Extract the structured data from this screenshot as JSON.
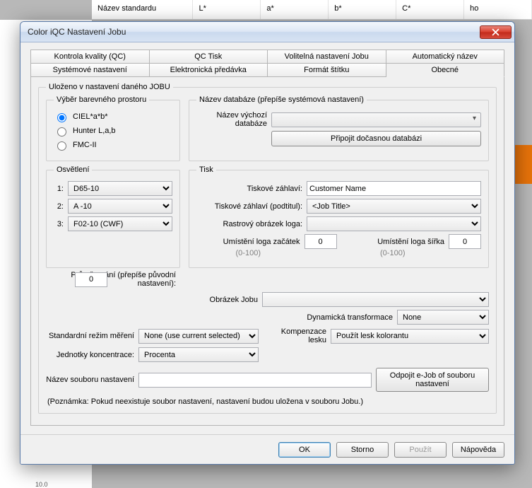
{
  "bg": {
    "headers": [
      "Název standardu",
      "L*",
      "a*",
      "b*",
      "C*",
      "ho"
    ],
    "ruler_tick": "10.0"
  },
  "dialog": {
    "title": "Color iQC Nastavení Jobu",
    "tabs_row1": [
      "Kontrola kvality (QC)",
      "QC Tisk",
      "Volitelná nastavení Jobu",
      "Automatický název"
    ],
    "tabs_row2": [
      "Systémové nastavení",
      "Elektronická předávka",
      "Formát štítku",
      "Obecné"
    ],
    "active_tab": "Obecné",
    "sections": {
      "saved": "Uloženo v nastavení daného JOBU",
      "color_space": {
        "legend": "Výběr barevného prostoru",
        "options": [
          "CIEL*a*b*",
          "Hunter L,a,b",
          "FMC-II"
        ],
        "selected": 0
      },
      "database": {
        "legend": "Název databáze (přepíše systémová nastavení)",
        "default_label": "Název výchozí databáze",
        "attach_btn": "Připojit dočasnou databázi"
      },
      "illum": {
        "legend": "Osvětlení",
        "rows": [
          {
            "n": "1:",
            "value": "D65-10"
          },
          {
            "n": "2:",
            "value": "A  -10"
          },
          {
            "n": "3:",
            "value": "F02-10 (CWF)"
          }
        ],
        "avg_label": "Průměrování (přepíše původní nastavení):",
        "avg_value": "0"
      },
      "print": {
        "legend": "Tisk",
        "header_label": "Tiskové záhlaví:",
        "header_value": "Customer Name",
        "subtitle_label": "Tiskové záhlaví (podtitul):",
        "subtitle_value": "<Job Title>",
        "raster_label": "Rastrový obrázek loga:",
        "logo_start_label": "Umístění loga začátek",
        "logo_start_value": "0",
        "logo_start_range": "(0-100)",
        "logo_width_label": "Umístění loga šířka",
        "logo_width_value": "0",
        "logo_width_range": "(0-100)"
      },
      "job_image_label": "Obrázek Jobu",
      "dyn_trans_label": "Dynamická transformace",
      "dyn_trans_value": "None",
      "meas_mode_label": "Standardní režim měření",
      "meas_mode_value": "None (use current selected)",
      "gloss_label": "Kompenzace lesku",
      "gloss_value": "Použít lesk kolorantu",
      "conc_label": "Jednotky koncentrace:",
      "conc_value": "Procenta",
      "settings_file_label": "Název souboru nastavení",
      "detach_btn": "Odpojit e-Job of souboru nastavení",
      "note": "(Poznámka: Pokud neexistuje soubor nastavení, nastavení budou uložena v souboru Jobu.)"
    },
    "buttons": {
      "ok": "OK",
      "cancel": "Storno",
      "apply": "Použít",
      "help": "Nápověda"
    }
  }
}
